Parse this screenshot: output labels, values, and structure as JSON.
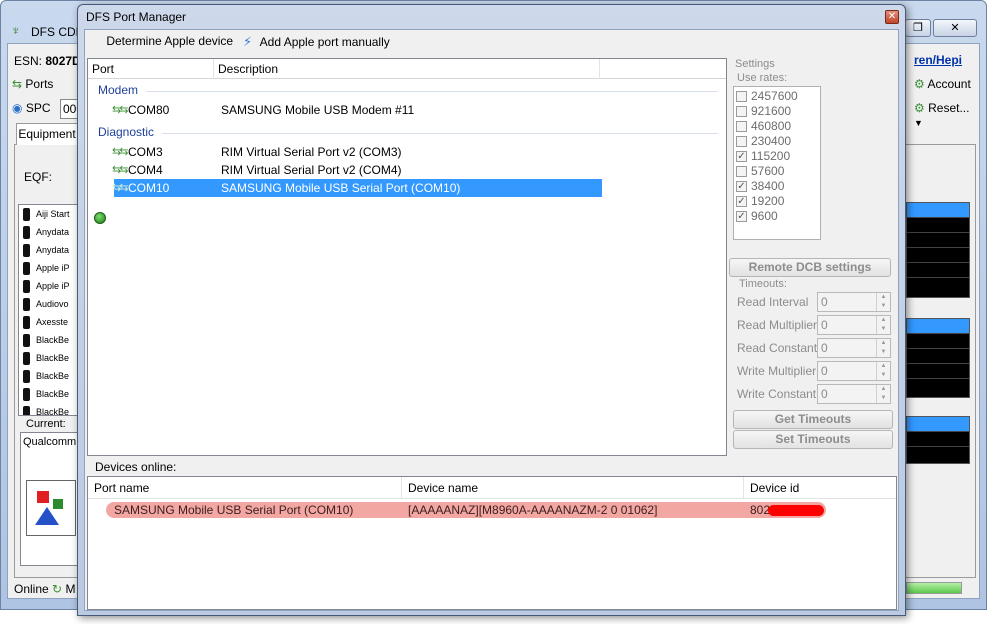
{
  "background_window": {
    "title": "DFS CDN",
    "esn_label": "ESN:",
    "esn_value": "8027D",
    "ports_label": "Ports",
    "spc_label": "SPC",
    "spc_value": "000",
    "tab_equipment": "Equipment",
    "eqf_label": "EQF:",
    "eq_items": [
      "Aiji Start",
      "Anydata",
      "Anydata",
      "Apple iP",
      "Apple iP",
      "Audiovo",
      "Axesste",
      "BlackBe",
      "BlackBe",
      "BlackBe",
      "BlackBe",
      "BlackBe"
    ],
    "current_label": "Current:",
    "current_value": "Qualcomm U",
    "status_text": "Online",
    "status_suffix": "M",
    "link_text": "ren/Hepi",
    "account_label": "Account",
    "reset_label": "Reset..."
  },
  "dialog": {
    "title": "DFS Port Manager",
    "toolbar": {
      "determine_label": "Determine Apple device",
      "add_manual_label": "Add Apple port manually"
    },
    "port_list": {
      "columns": [
        "Port",
        "Description"
      ],
      "groups": [
        {
          "name": "Modem",
          "ports": [
            {
              "port": "COM80",
              "description": "SAMSUNG Mobile USB Modem #11"
            }
          ]
        },
        {
          "name": "Diagnostic",
          "ports": [
            {
              "port": "COM3",
              "description": "RIM Virtual Serial Port v2 (COM3)"
            },
            {
              "port": "COM4",
              "description": "RIM Virtual Serial Port v2 (COM4)"
            },
            {
              "port": "COM10",
              "description": "SAMSUNG Mobile USB Serial Port  (COM10)",
              "selected": true
            }
          ]
        }
      ]
    },
    "settings": {
      "label": "Settings",
      "use_rates_label": "Use rates:",
      "rates": [
        {
          "value": "2457600",
          "checked": false
        },
        {
          "value": "921600",
          "checked": false
        },
        {
          "value": "460800",
          "checked": false
        },
        {
          "value": "230400",
          "checked": false
        },
        {
          "value": "115200",
          "checked": true
        },
        {
          "value": "57600",
          "checked": false
        },
        {
          "value": "38400",
          "checked": true
        },
        {
          "value": "19200",
          "checked": true
        },
        {
          "value": "9600",
          "checked": true
        }
      ],
      "remote_dcb_label": "Remote DCB settings",
      "timeouts_label": "Timeouts:",
      "timeouts": [
        {
          "label": "Read Interval",
          "value": "0"
        },
        {
          "label": "Read Multiplier:",
          "value": "0"
        },
        {
          "label": "Read Constant:",
          "value": "0"
        },
        {
          "label": "Write Multiplier:",
          "value": "0"
        },
        {
          "label": "Write Constant:",
          "value": "0"
        }
      ],
      "get_timeouts_label": "Get Timeouts",
      "set_timeouts_label": "Set Timeouts"
    },
    "devices": {
      "label": "Devices online:",
      "columns": [
        "Port name",
        "Device name",
        "Device id"
      ],
      "rows": [
        {
          "port_name": "SAMSUNG Mobile USB Serial Port  (COM10)",
          "device_name": "[AAAAANAZ][M8960A-AAAANAZM-2 0 01062]",
          "device_id": "802"
        }
      ]
    }
  }
}
